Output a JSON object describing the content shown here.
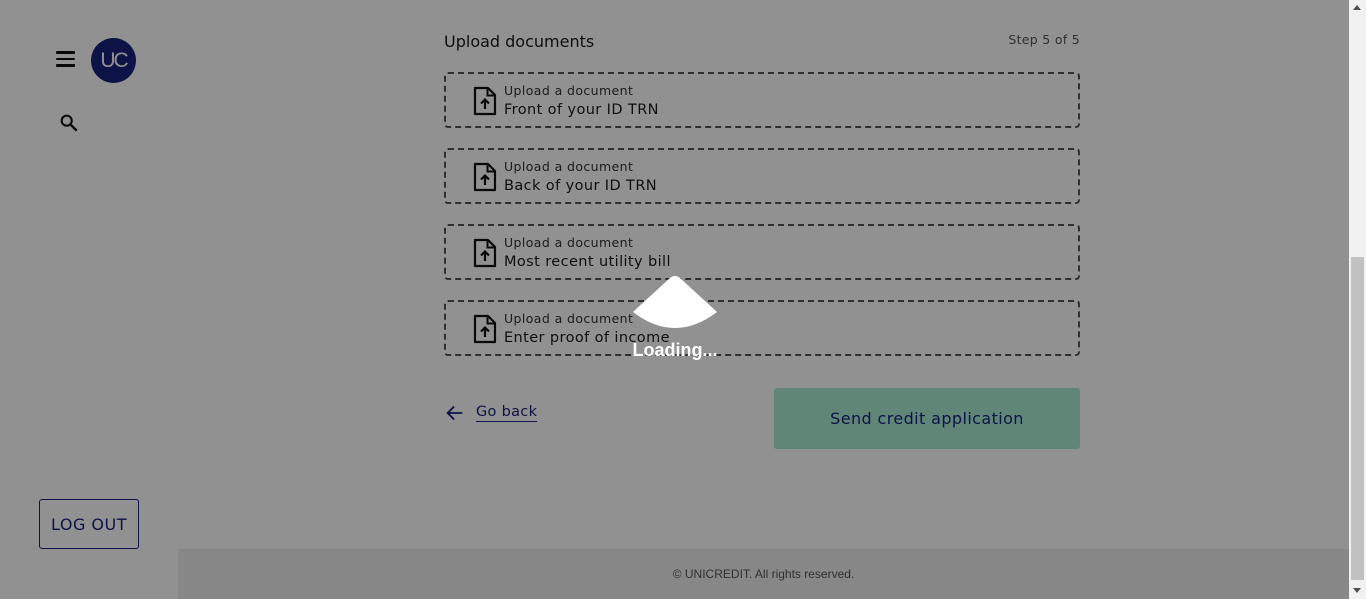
{
  "sidebar": {
    "avatar_text": "UC",
    "menu_icon": "hamburger-menu-icon",
    "search_icon": "search-icon",
    "logout_label": "LOG OUT"
  },
  "form": {
    "title": "Upload documents",
    "step": "Step 5 of 5",
    "uploads": [
      {
        "label": "Upload a document",
        "name": "Front of your ID TRN"
      },
      {
        "label": "Upload a document",
        "name": "Back of your ID TRN"
      },
      {
        "label": "Upload a document",
        "name": "Most recent utility bill"
      },
      {
        "label": "Upload a document",
        "name": "Enter proof of income"
      }
    ],
    "go_back_label": "Go back",
    "submit_label": "Send credit application"
  },
  "footer": {
    "text": "© UNICREDIT. All rights reserved."
  },
  "overlay": {
    "loading_text": "Loading..."
  },
  "colors": {
    "brand": "#1a237e",
    "submit_bg": "#a8ebd2",
    "overlay": "rgba(0,0,0,0.43)"
  }
}
